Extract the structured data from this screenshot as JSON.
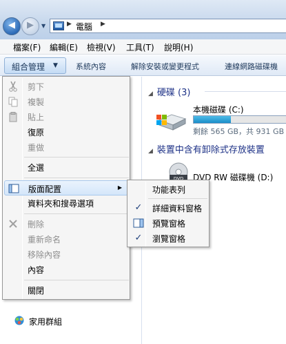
{
  "address": {
    "path_label": "電腦",
    "back_label": "◀",
    "forward_label": "▶"
  },
  "menubar": {
    "items": [
      "檔案(F)",
      "編輯(E)",
      "檢視(V)",
      "工具(T)",
      "說明(H)"
    ]
  },
  "toolbar": {
    "organize_label": "組合管理",
    "buttons": [
      "系統內容",
      "解除安裝或變更程式",
      "連線網路磁碟機"
    ]
  },
  "content": {
    "hdd_group": "硬碟 (3)",
    "removable_group": "裝置中含有卸除式存放裝置",
    "drive_c": {
      "name": "本機磁碟 (C:)",
      "info": "剩餘 565 GB，共 931 GB",
      "used_fraction": 0.39
    },
    "dvd": {
      "name": "DVD RW 磁碟機 (D:)"
    }
  },
  "navpane": {
    "homegroup_label": "家用群組"
  },
  "organize_menu": {
    "cut": "剪下",
    "copy": "複製",
    "paste": "貼上",
    "undo": "復原",
    "redo": "重做",
    "select_all": "全選",
    "layout": "版面配置",
    "folder_options": "資料夾和搜尋選項",
    "delete": "刪除",
    "rename": "重新命名",
    "remove_properties": "移除內容",
    "properties": "內容",
    "close": "關閉"
  },
  "layout_submenu": {
    "menu_bar": "功能表列",
    "details_pane": "詳細資料窗格",
    "preview_pane": "預覽窗格",
    "navigation_pane": "瀏覽窗格"
  },
  "colors": {
    "accent": "#1e3287",
    "highlight_border": "#a8c8ec",
    "capacity_fill": "#1a8dc8"
  }
}
